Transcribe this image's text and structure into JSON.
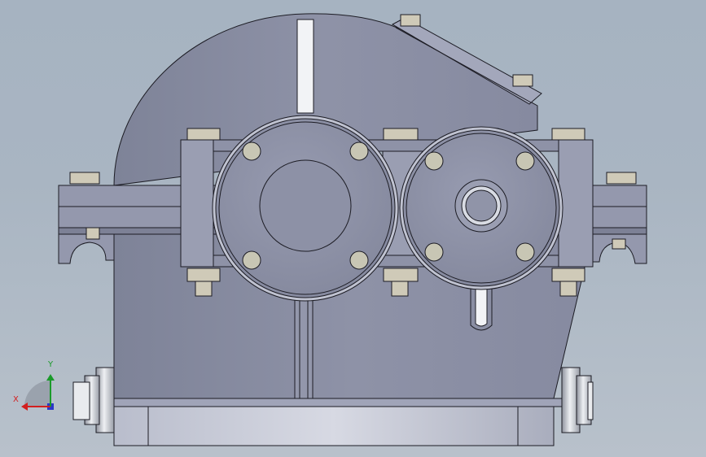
{
  "viewport": {
    "background_top": "#a6b3c1",
    "background_bottom": "#b8c1cb"
  },
  "model": {
    "body_color": "#8b8fa4",
    "body_light": "#9ea2b6",
    "edge_color": "#1c1c24",
    "steel_color": "#c9ccd3"
  },
  "triad": {
    "x_label": "X",
    "y_label": "Y",
    "x_color": "#d21f1f",
    "y_color": "#1a9a2a",
    "z_color": "#2a37c8"
  }
}
